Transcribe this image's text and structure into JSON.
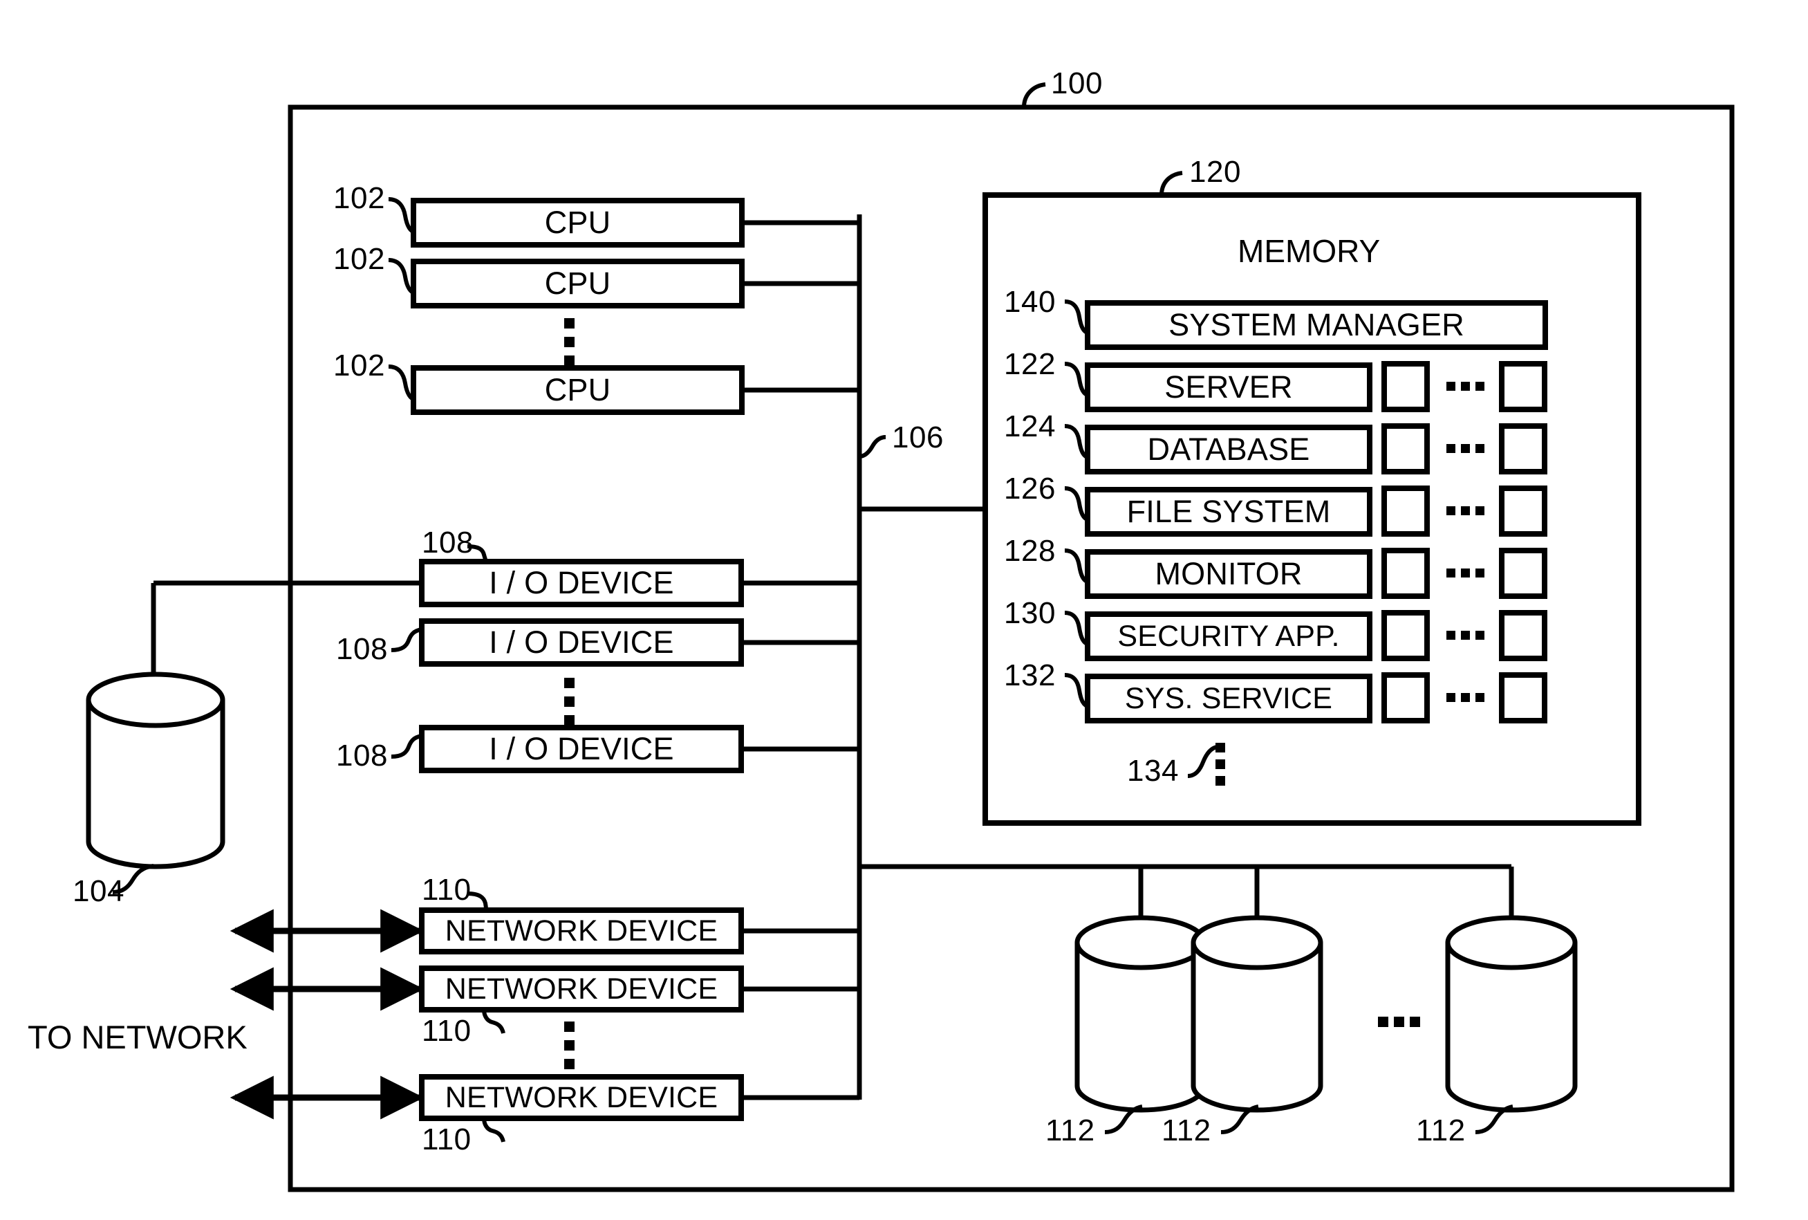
{
  "figure": {
    "system_ref": "100",
    "bus_ref": "106",
    "memory_ref": "120",
    "memory_title": "MEMORY",
    "storage_ref": "104",
    "network_caption": "TO NETWORK",
    "more_modules_ref": "134"
  },
  "cpus": [
    {
      "ref": "102",
      "label": "CPU"
    },
    {
      "ref": "102",
      "label": "CPU"
    },
    {
      "ref": "102",
      "label": "CPU"
    }
  ],
  "io_devices": [
    {
      "ref": "108",
      "label": "I / O DEVICE"
    },
    {
      "ref": "108",
      "label": "I / O DEVICE"
    },
    {
      "ref": "108",
      "label": "I / O DEVICE"
    }
  ],
  "network_devices": [
    {
      "ref": "110",
      "label": "NETWORK DEVICE"
    },
    {
      "ref": "110",
      "label": "NETWORK DEVICE"
    },
    {
      "ref": "110",
      "label": "NETWORK DEVICE"
    }
  ],
  "memory_modules": [
    {
      "ref": "140",
      "label": "SYSTEM MANAGER",
      "has_instances": false
    },
    {
      "ref": "122",
      "label": "SERVER",
      "has_instances": true
    },
    {
      "ref": "124",
      "label": "DATABASE",
      "has_instances": true
    },
    {
      "ref": "126",
      "label": "FILE SYSTEM",
      "has_instances": true
    },
    {
      "ref": "128",
      "label": "MONITOR",
      "has_instances": true
    },
    {
      "ref": "130",
      "label": "SECURITY APP.",
      "has_instances": true
    },
    {
      "ref": "132",
      "label": "SYS. SERVICE",
      "has_instances": true
    }
  ],
  "disk_array": [
    {
      "ref": "112"
    },
    {
      "ref": "112"
    },
    {
      "ref": "112"
    }
  ],
  "colors": {
    "line": "#000000",
    "background": "#ffffff",
    "text": "#000000"
  }
}
